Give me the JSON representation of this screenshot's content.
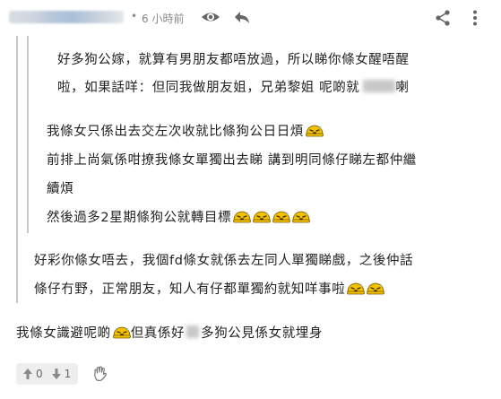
{
  "header": {
    "separator": "•",
    "timestamp": "6 小時前"
  },
  "quote_level3": {
    "line1": "好多狗公嫁，就算有男朋友都唔放過，所以睇你條女醒唔醒",
    "line2_before": "啦，如果話咩：但同我做朋友姐，兄弟黎姐 呢啲就",
    "line2_after": "喇"
  },
  "quote_level2": {
    "line1": "我條女只係出去交左次收就比條狗公日日煩",
    "line2": "前排上尚氣係咁撩我條女單獨出去睇 講到明同條仔睇左都仲繼",
    "line3": "續煩",
    "line4": "然後過多2星期條狗公就轉目標"
  },
  "quote_level1": {
    "line1": "好彩你條女唔去，我個fd條女就係去左同人單獨睇戲，之後仲話",
    "line2": "條仔冇野，正常朋友，知人有仔都單獨約就知咩事啦"
  },
  "reply": {
    "text_before": "我條女識避呢啲",
    "text_mid": "但真係好",
    "text_after": "多狗公見係女就埋身"
  },
  "footer": {
    "upvotes": "0",
    "downvotes": "1"
  },
  "icons": {
    "eye": "eye-icon",
    "reply": "reply-icon",
    "share": "share-icon",
    "more": "more-vertical-icon",
    "emoji": "sweat-emoji-icon",
    "upvote": "arrow-up-icon",
    "downvote": "arrow-down-icon",
    "wave": "waving-hand-icon"
  },
  "colors": {
    "meta": "#888888",
    "quote_border": "#c9c9c9",
    "emoji_yellow": "#f2c200"
  }
}
